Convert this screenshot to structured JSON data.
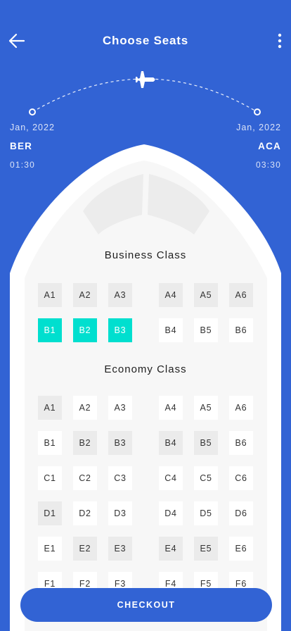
{
  "header": {
    "title": "Choose Seats",
    "back_icon": "arrow-left-icon",
    "menu_icon": "more-vertical-icon"
  },
  "route": {
    "from": {
      "date": "Jan, 2022",
      "code": "BER",
      "time": "01:30"
    },
    "to": {
      "date": "Jan, 2022",
      "code": "ACA",
      "time": "03:30"
    },
    "plane_icon": "airplane-icon"
  },
  "business": {
    "title": "Business Class",
    "rows": [
      {
        "seats": [
          {
            "label": "A1",
            "state": "taken"
          },
          {
            "label": "A2",
            "state": "taken"
          },
          {
            "label": "A3",
            "state": "taken"
          },
          {
            "label": "A4",
            "state": "taken"
          },
          {
            "label": "A5",
            "state": "taken"
          },
          {
            "label": "A6",
            "state": "taken"
          }
        ]
      },
      {
        "seats": [
          {
            "label": "B1",
            "state": "selected"
          },
          {
            "label": "B2",
            "state": "selected"
          },
          {
            "label": "B3",
            "state": "selected"
          },
          {
            "label": "B4",
            "state": "available"
          },
          {
            "label": "B5",
            "state": "available"
          },
          {
            "label": "B6",
            "state": "available"
          }
        ]
      }
    ]
  },
  "economy": {
    "title": "Economy Class",
    "rows": [
      {
        "seats": [
          {
            "label": "A1",
            "state": "taken"
          },
          {
            "label": "A2",
            "state": "available"
          },
          {
            "label": "A3",
            "state": "available"
          },
          {
            "label": "A4",
            "state": "available"
          },
          {
            "label": "A5",
            "state": "available"
          },
          {
            "label": "A6",
            "state": "available"
          }
        ]
      },
      {
        "seats": [
          {
            "label": "B1",
            "state": "available"
          },
          {
            "label": "B2",
            "state": "taken"
          },
          {
            "label": "B3",
            "state": "taken"
          },
          {
            "label": "B4",
            "state": "taken"
          },
          {
            "label": "B5",
            "state": "taken"
          },
          {
            "label": "B6",
            "state": "available"
          }
        ]
      },
      {
        "seats": [
          {
            "label": "C1",
            "state": "available"
          },
          {
            "label": "C2",
            "state": "available"
          },
          {
            "label": "C3",
            "state": "available"
          },
          {
            "label": "C4",
            "state": "available"
          },
          {
            "label": "C5",
            "state": "available"
          },
          {
            "label": "C6",
            "state": "available"
          }
        ]
      },
      {
        "seats": [
          {
            "label": "D1",
            "state": "taken"
          },
          {
            "label": "D2",
            "state": "available"
          },
          {
            "label": "D3",
            "state": "available"
          },
          {
            "label": "D4",
            "state": "available"
          },
          {
            "label": "D5",
            "state": "available"
          },
          {
            "label": "D6",
            "state": "available"
          }
        ]
      },
      {
        "seats": [
          {
            "label": "E1",
            "state": "available"
          },
          {
            "label": "E2",
            "state": "taken"
          },
          {
            "label": "E3",
            "state": "taken"
          },
          {
            "label": "E4",
            "state": "taken"
          },
          {
            "label": "E5",
            "state": "taken"
          },
          {
            "label": "E6",
            "state": "available"
          }
        ]
      },
      {
        "seats": [
          {
            "label": "F1",
            "state": "available"
          },
          {
            "label": "F2",
            "state": "available"
          },
          {
            "label": "F3",
            "state": "available"
          },
          {
            "label": "F4",
            "state": "available"
          },
          {
            "label": "F5",
            "state": "available"
          },
          {
            "label": "F6",
            "state": "available"
          }
        ]
      }
    ]
  },
  "checkout_label": "CHECKOUT",
  "colors": {
    "background": "#3263d4",
    "selected": "#00dfcf",
    "taken": "#ebebeb",
    "cabin": "#f7f7f7"
  }
}
